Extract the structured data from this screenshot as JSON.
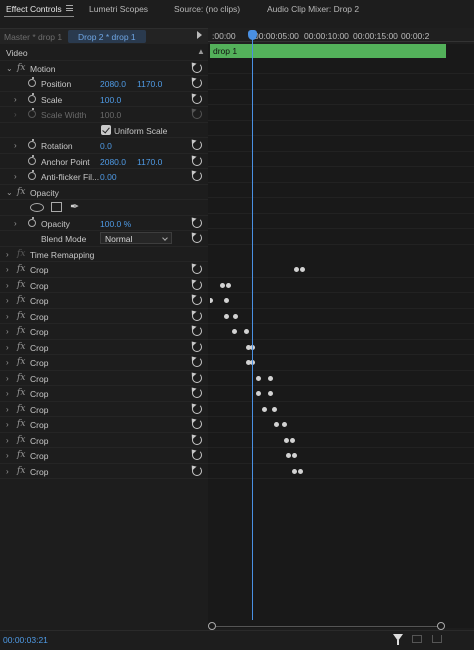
{
  "tabs": [
    {
      "label": "Effect Controls",
      "active": true
    },
    {
      "label": "Lumetri Scopes",
      "active": false
    },
    {
      "label": "Source: (no clips)",
      "active": false
    },
    {
      "label": "Audio Clip Mixer: Drop 2",
      "active": false
    }
  ],
  "clipbar": {
    "master": "Master * drop 1",
    "sequence": "Drop 2 * drop 1"
  },
  "ruler": {
    "labels": [
      ":00:00",
      "00:00:05:00",
      "00:00:10:00",
      "00:00:15:00",
      "00:00:2"
    ]
  },
  "timeline_clip": {
    "label": "drop 1",
    "color": "#53b15a"
  },
  "section": "Video",
  "motion": {
    "name": "Motion",
    "position": {
      "label": "Position",
      "x": "2080.0",
      "y": "1170.0"
    },
    "scale": {
      "label": "Scale",
      "value": "100.0"
    },
    "scale_width": {
      "label": "Scale Width",
      "value": "100.0"
    },
    "uniform_scale": {
      "label": "Uniform Scale",
      "checked": true
    },
    "rotation": {
      "label": "Rotation",
      "value": "0.0"
    },
    "anchor_point": {
      "label": "Anchor Point",
      "x": "2080.0",
      "y": "1170.0"
    },
    "anti_flicker": {
      "label": "Anti-flicker Fil...",
      "value": "0.00"
    }
  },
  "opacity": {
    "name": "Opacity",
    "opacity": {
      "label": "Opacity",
      "value": "100.0 %"
    },
    "blend_mode": {
      "label": "Blend Mode",
      "value": "Normal"
    }
  },
  "time_remapping": {
    "name": "Time Remapping"
  },
  "crop_label": "Crop",
  "crop_rows": [
    {
      "keyframes": [
        86,
        92
      ]
    },
    {
      "keyframes": [
        12,
        18
      ]
    },
    {
      "keyframes": [
        2,
        16
      ]
    },
    {
      "keyframes": [
        16,
        25
      ]
    },
    {
      "keyframes": [
        24,
        36
      ]
    },
    {
      "keyframes": [
        38,
        42
      ]
    },
    {
      "keyframes": [
        38,
        42
      ]
    },
    {
      "keyframes": [
        48,
        60
      ]
    },
    {
      "keyframes": [
        48,
        60
      ]
    },
    {
      "keyframes": [
        54,
        64
      ]
    },
    {
      "keyframes": [
        66,
        74
      ]
    },
    {
      "keyframes": [
        76,
        82
      ]
    },
    {
      "keyframes": [
        78,
        84
      ]
    },
    {
      "keyframes": [
        84,
        90
      ]
    }
  ],
  "timecode": "00:00:03:21",
  "colors": {
    "accent": "#4a90e2",
    "value_blue": "#4f9be6",
    "clip_green": "#53b15a"
  }
}
